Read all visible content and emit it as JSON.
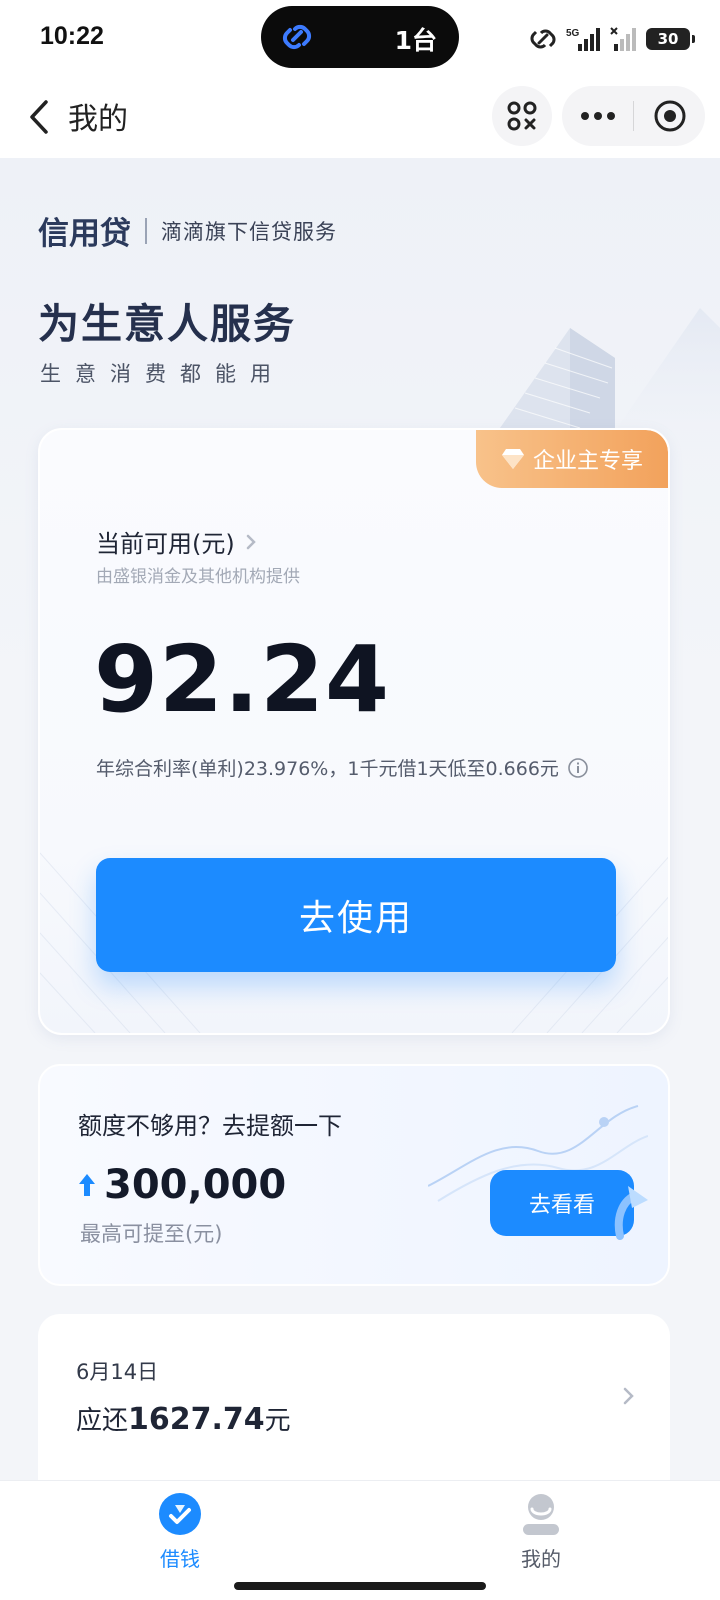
{
  "status_bar": {
    "time": "10:22",
    "island_text": "1台",
    "battery": "30",
    "network": "5G"
  },
  "nav": {
    "title": "我的",
    "icons": [
      "back-arrow-icon",
      "scan-icon",
      "more-icon",
      "close-miniprogram-icon"
    ]
  },
  "brand": {
    "name": "信用贷",
    "subtitle": "滴滴旗下信贷服务"
  },
  "hero": {
    "title": "为生意人服务",
    "subtitle": "生意消费都能用"
  },
  "credit_card": {
    "tag": "企业主专享",
    "available_label": "当前可用(元)",
    "provider_note": "由盛银消金及其他机构提供",
    "available_amount": "92.24",
    "rate_text": "年综合利率(单利)23.976%，1千元借1天低至0.666元",
    "use_button": "去使用"
  },
  "limit_card": {
    "title": "额度不够用？去提额一下",
    "amount": "300,000",
    "note": "最高可提至(元)",
    "button": "去看看"
  },
  "repay_card": {
    "date": "6月14日",
    "prefix": "应还",
    "amount": "1627.74",
    "suffix": "元"
  },
  "tabs": [
    {
      "label": "借钱",
      "icon": "borrow-icon",
      "active": true
    },
    {
      "label": "我的",
      "icon": "profile-icon",
      "active": false
    }
  ],
  "colors": {
    "accent": "#1c8bff",
    "vip_tag": "#f2a25c",
    "title_dark": "#25304d"
  }
}
